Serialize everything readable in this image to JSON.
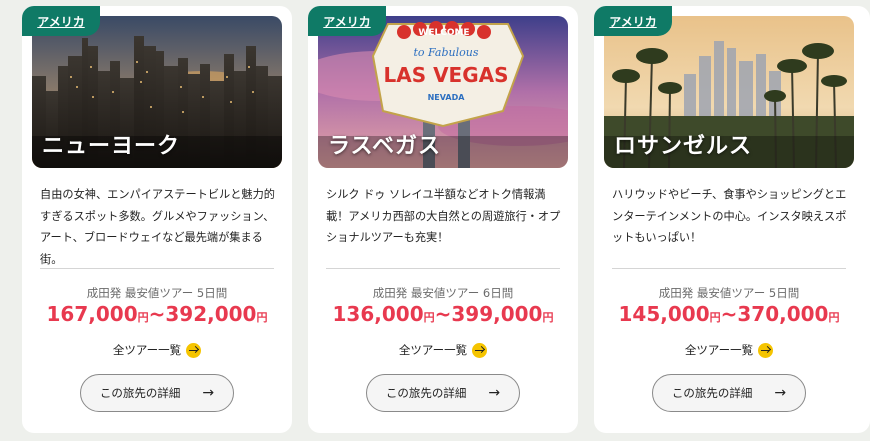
{
  "cards": [
    {
      "tag": "アメリカ",
      "city": "ニューヨーク",
      "description": "自由の女神、エンパイアステートビルと魅力的すぎるスポット多数。グルメやファッション、アート、ブロードウェイなど最先端が集まる街。",
      "tour_info": "成田発 最安値ツアー 5日間",
      "price_low": "167,000",
      "price_high": "392,000",
      "yen": "円",
      "tilde": "~",
      "tour_list_label": "全ツアー一覧",
      "detail_label": "この旅先の詳細"
    },
    {
      "tag": "アメリカ",
      "city": "ラスベガス",
      "description": "シルク ドゥ ソレイユ半額などオトク情報満載！アメリカ西部の大自然との周遊旅行・オプショナルツアーも充実！",
      "tour_info": "成田発 最安値ツアー 6日間",
      "price_low": "136,000",
      "price_high": "399,000",
      "yen": "円",
      "tilde": "~",
      "tour_list_label": "全ツアー一覧",
      "detail_label": "この旅先の詳細",
      "sign": {
        "top": "WELCOME",
        "mid": "to Fabulous",
        "main": "LAS VEGAS",
        "bottom": "NEVADA"
      }
    },
    {
      "tag": "アメリカ",
      "city": "ロサンゼルス",
      "description": "ハリウッドやビーチ、食事やショッピングとエンターテインメントの中心。インスタ映えスポットもいっぱい！",
      "tour_info": "成田発 最安値ツアー 5日間",
      "price_low": "145,000",
      "price_high": "370,000",
      "yen": "円",
      "tilde": "~",
      "tour_list_label": "全ツアー一覧",
      "detail_label": "この旅先の詳細"
    }
  ],
  "colors": {
    "tag_bg": "#0f7a66",
    "price": "#e8394f",
    "arrow_circle": "#f5c400"
  },
  "icons": {
    "tour_list": "arrow-right-circle-icon",
    "detail": "arrow-right-icon"
  }
}
